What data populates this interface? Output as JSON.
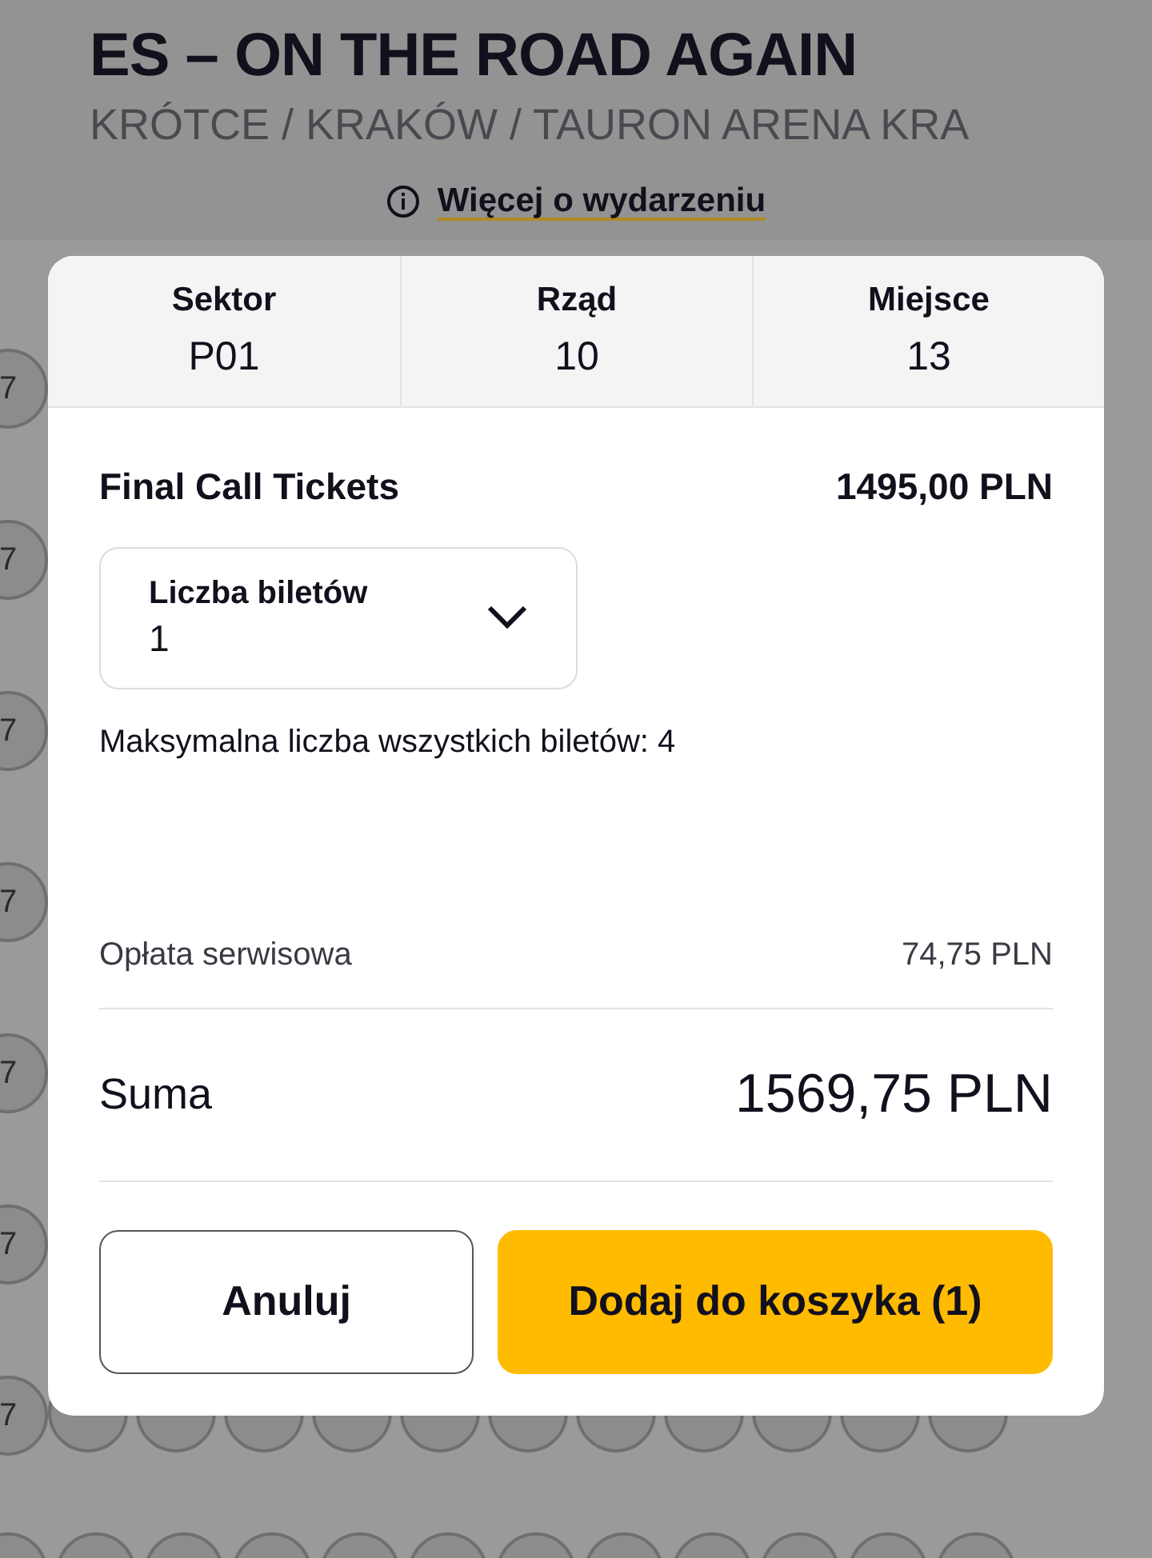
{
  "event": {
    "title": "ES – ON THE ROAD AGAIN",
    "subtitle": "KRÓTCE / KRAKÓW / TAURON ARENA KRA",
    "more_link": "Więcej o wydarzeniu"
  },
  "seat_map": {
    "edge_rows": [
      "7",
      "7",
      "7",
      "7",
      "7",
      "7",
      "7"
    ]
  },
  "dialog": {
    "seat_info": [
      {
        "label": "Sektor",
        "value": "P01"
      },
      {
        "label": "Rząd",
        "value": "10"
      },
      {
        "label": "Miejsce",
        "value": "13"
      }
    ],
    "ticket_type": "Final Call Tickets",
    "ticket_price": "1495,00 PLN",
    "quantity": {
      "label": "Liczba biletów",
      "value": "1"
    },
    "max_note": "Maksymalna liczba wszystkich biletów: 4",
    "service_fee": {
      "label": "Opłata serwisowa",
      "value": "74,75 PLN"
    },
    "total": {
      "label": "Suma",
      "value": "1569,75 PLN"
    },
    "buttons": [
      {
        "label": "Anuluj",
        "kind": "secondary"
      },
      {
        "label": "Dodaj do koszyka (1)",
        "kind": "primary"
      }
    ]
  }
}
